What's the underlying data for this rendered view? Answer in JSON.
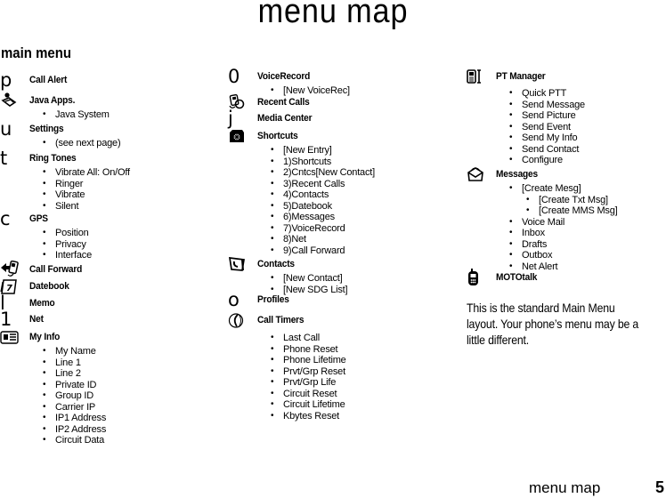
{
  "page": {
    "title": "menu map",
    "section_title": "main menu",
    "note": "This is the standard Main Menu layout. Your phone’s menu may be a little different.",
    "footer_label": "menu map",
    "page_number": "5"
  },
  "columns": [
    {
      "entries": [
        {
          "icon": "call-alert-icon",
          "glyph": "p",
          "label": "Call Alert",
          "subs": []
        },
        {
          "icon": "java-apps-icon",
          "glyph": "",
          "label": "Java Apps.",
          "subs": [
            "Java System"
          ]
        },
        {
          "icon": "settings-icon",
          "glyph": "u",
          "label": "Settings",
          "subs": [
            "(see next page)"
          ]
        },
        {
          "icon": "ring-tones-icon",
          "glyph": "t",
          "label": "Ring Tones",
          "subs": [
            "Vibrate All: On/Off",
            "Ringer",
            "Vibrate",
            "Silent"
          ]
        },
        {
          "icon": "gps-icon",
          "glyph": "c",
          "label": "GPS",
          "subs": [
            "Position",
            "Privacy",
            "Interface"
          ]
        },
        {
          "icon": "call-forward-icon",
          "glyph": "",
          "label": "Call Forward",
          "subs": []
        },
        {
          "icon": "datebook-icon",
          "glyph": "",
          "label": "Datebook",
          "subs": []
        },
        {
          "icon": "memo-icon",
          "glyph": "l",
          "label": "Memo",
          "subs": []
        },
        {
          "icon": "net-icon",
          "glyph": "1",
          "label": "Net",
          "subs": []
        },
        {
          "icon": "my-info-icon",
          "glyph": "",
          "label": "My Info",
          "subs": [
            "My Name",
            "Line 1",
            "Line 2",
            "Private ID",
            "Group ID",
            "Carrier IP",
            "IP1 Address",
            "IP2 Address",
            "Circuit Data"
          ]
        }
      ]
    },
    {
      "entries": [
        {
          "icon": "voice-record-icon",
          "glyph": "0",
          "label": "VoiceRecord",
          "subs": [
            "[New VoiceRec]"
          ]
        },
        {
          "icon": "recent-calls-icon",
          "glyph": "",
          "label": "Recent Calls",
          "subs": []
        },
        {
          "icon": "media-center-icon",
          "glyph": "j",
          "label": "Media Center",
          "subs": []
        },
        {
          "icon": "shortcuts-icon",
          "glyph": "",
          "label": "Shortcuts",
          "subs": [
            "[New Entry]",
            "1)Shortcuts",
            "2)Cntcs[New Contact]",
            "3)Recent Calls",
            "4)Contacts",
            "5)Datebook",
            "6)Messages",
            "7)VoiceRecord",
            "8)Net",
            "9)Call Forward"
          ]
        },
        {
          "icon": "contacts-icon",
          "glyph": "",
          "label": "Contacts",
          "subs": [
            "[New Contact]",
            "[New SDG List]"
          ]
        },
        {
          "icon": "profiles-icon",
          "glyph": "o",
          "label": "Profiles",
          "subs": []
        },
        {
          "icon": "call-timers-icon",
          "glyph": "",
          "label": "Call Timers",
          "subs": [
            "Last Call",
            "Phone Reset",
            "Phone Lifetime",
            "Prvt/Grp Reset",
            "Prvt/Grp Life",
            "Circuit Reset",
            "Circuit Lifetime",
            "Kbytes Reset"
          ]
        }
      ]
    },
    {
      "entries": [
        {
          "icon": "pt-manager-icon",
          "glyph": "",
          "label": "PT Manager",
          "subs": [
            "Quick PTT",
            "Send Message",
            "Send Picture",
            "Send Event",
            "Send My Info",
            "Send Contact",
            "Configure"
          ]
        },
        {
          "icon": "messages-icon",
          "glyph": "",
          "label": "Messages",
          "subs": [
            "[Create Mesg]",
            "[Create Txt Msg]",
            "[Create MMS Msg]",
            "Voice Mail",
            "Inbox",
            "Drafts",
            "Outbox",
            "Net Alert"
          ],
          "sub_levels": [
            1,
            2,
            2,
            1,
            1,
            1,
            1,
            1
          ]
        },
        {
          "icon": "mototalk-icon",
          "glyph": "",
          "label": "MOTOtalk",
          "subs": []
        }
      ]
    }
  ]
}
